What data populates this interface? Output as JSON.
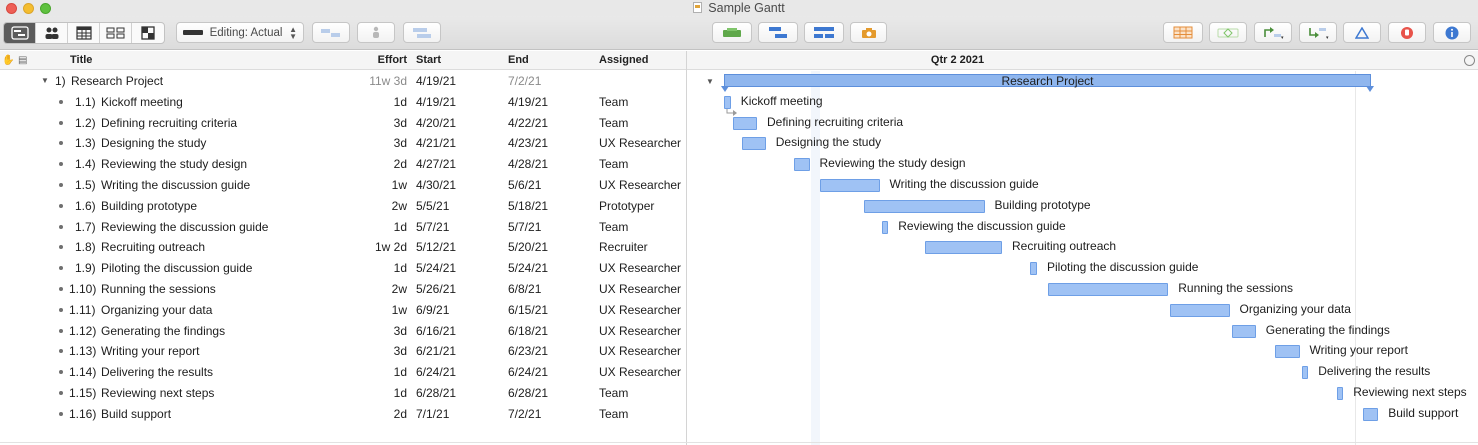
{
  "window": {
    "title": "Sample Gantt"
  },
  "toolbar": {
    "view_segments": [
      "outline-view-icon",
      "resources-view-icon",
      "calendar-view-icon",
      "network-view-icon",
      "styles-view-icon"
    ],
    "editing_select": {
      "value": "Editing: Actual"
    }
  },
  "columns": {
    "title": "Title",
    "effort": "Effort",
    "start": "Start",
    "end": "End",
    "assigned": "Assigned"
  },
  "gantt_header": {
    "period": "Qtr 2 2021"
  },
  "project": {
    "number": "1)",
    "title": "Research Project",
    "effort": "11w 3d",
    "start": "4/19/21",
    "end": "7/2/21",
    "bar_label": "Research Project"
  },
  "tasks": [
    {
      "number": "1.1)",
      "title": "Kickoff meeting",
      "effort": "1d",
      "start": "4/19/21",
      "end": "4/19/21",
      "assigned": "Team"
    },
    {
      "number": "1.2)",
      "title": "Defining recruiting criteria",
      "effort": "3d",
      "start": "4/20/21",
      "end": "4/22/21",
      "assigned": "Team"
    },
    {
      "number": "1.3)",
      "title": "Designing the study",
      "effort": "3d",
      "start": "4/21/21",
      "end": "4/23/21",
      "assigned": "UX Researcher"
    },
    {
      "number": "1.4)",
      "title": "Reviewing the study design",
      "effort": "2d",
      "start": "4/27/21",
      "end": "4/28/21",
      "assigned": "Team"
    },
    {
      "number": "1.5)",
      "title": "Writing the discussion guide",
      "effort": "1w",
      "start": "4/30/21",
      "end": "5/6/21",
      "assigned": "UX Researcher"
    },
    {
      "number": "1.6)",
      "title": "Building prototype",
      "effort": "2w",
      "start": "5/5/21",
      "end": "5/18/21",
      "assigned": "Prototyper"
    },
    {
      "number": "1.7)",
      "title": "Reviewing the discussion guide",
      "effort": "1d",
      "start": "5/7/21",
      "end": "5/7/21",
      "assigned": "Team"
    },
    {
      "number": "1.8)",
      "title": "Recruiting outreach",
      "effort": "1w 2d",
      "start": "5/12/21",
      "end": "5/20/21",
      "assigned": "Recruiter"
    },
    {
      "number": "1.9)",
      "title": "Piloting the discussion guide",
      "effort": "1d",
      "start": "5/24/21",
      "end": "5/24/21",
      "assigned": "UX Researcher"
    },
    {
      "number": "1.10)",
      "title": "Running the sessions",
      "effort": "2w",
      "start": "5/26/21",
      "end": "6/8/21",
      "assigned": "UX Researcher"
    },
    {
      "number": "1.11)",
      "title": "Organizing your data",
      "effort": "1w",
      "start": "6/9/21",
      "end": "6/15/21",
      "assigned": "UX Researcher"
    },
    {
      "number": "1.12)",
      "title": "Generating the findings",
      "effort": "3d",
      "start": "6/16/21",
      "end": "6/18/21",
      "assigned": "UX Researcher"
    },
    {
      "number": "1.13)",
      "title": "Writing your report",
      "effort": "3d",
      "start": "6/21/21",
      "end": "6/23/21",
      "assigned": "UX Researcher"
    },
    {
      "number": "1.14)",
      "title": "Delivering the results",
      "effort": "1d",
      "start": "6/24/21",
      "end": "6/24/21",
      "assigned": "UX Researcher"
    },
    {
      "number": "1.15)",
      "title": "Reviewing next steps",
      "effort": "1d",
      "start": "6/28/21",
      "end": "6/28/21",
      "assigned": "Team"
    },
    {
      "number": "1.16)",
      "title": "Build support",
      "effort": "2d",
      "start": "7/1/21",
      "end": "7/2/21",
      "assigned": "Team"
    }
  ],
  "colors": {
    "bar_fill": "#9fc2f4",
    "bar_border": "#6e9fe6",
    "summary_fill": "#8fb6ee"
  }
}
